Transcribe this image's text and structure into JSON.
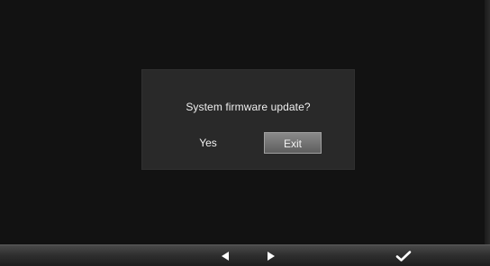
{
  "dialog": {
    "message": "System firmware update?",
    "options": [
      {
        "label": "Yes",
        "selected": false
      },
      {
        "label": "Exit",
        "selected": true
      }
    ]
  },
  "bottom_bar": {
    "buttons": [
      {
        "icon": "triangle-left-icon",
        "action": "previous"
      },
      {
        "icon": "triangle-right-icon",
        "action": "next"
      },
      {
        "icon": "checkmark-icon",
        "action": "confirm"
      }
    ]
  },
  "colors": {
    "screen_background": "#121212",
    "dialog_background": "#292929",
    "selected_option": "#6f6f6f",
    "text": "#efefef"
  }
}
